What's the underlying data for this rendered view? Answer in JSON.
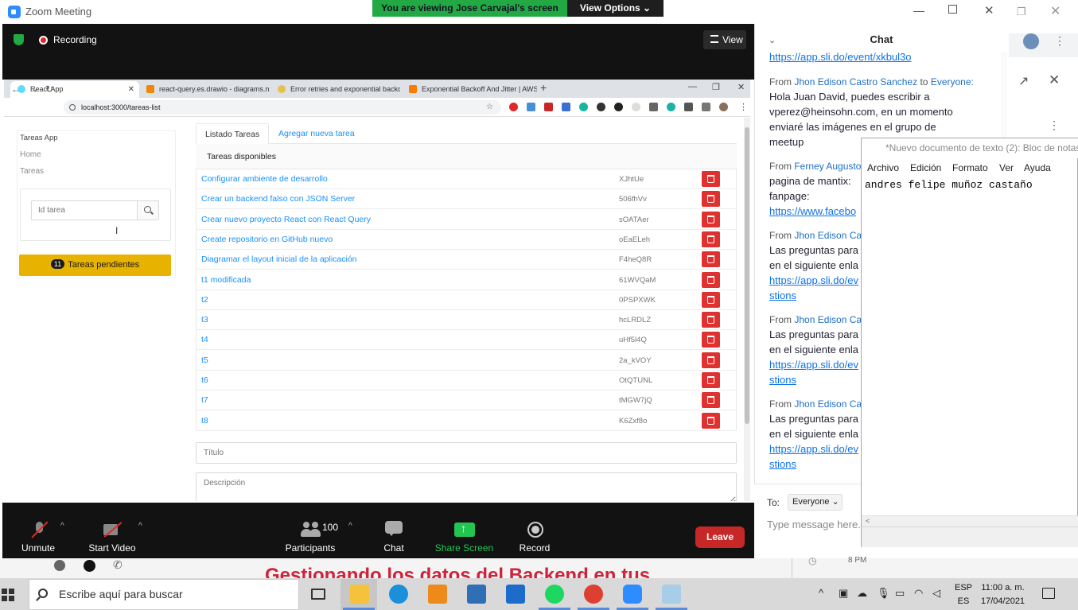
{
  "zoom": {
    "title": "Zoom Meeting",
    "viewing_banner": "You are viewing Jose Carvajal's screen",
    "view_options": "View Options ⌄",
    "recording": "Recording",
    "view": "View",
    "controls": {
      "unmute": "Unmute",
      "start_video": "Start Video",
      "participants": "Participants",
      "participant_count": "100",
      "chat": "Chat",
      "share_screen": "Share Screen",
      "record": "Record",
      "leave": "Leave"
    }
  },
  "chrome": {
    "tabs": [
      {
        "label": "React App",
        "active": true
      },
      {
        "label": "react-query.es.drawio - diagrams.net"
      },
      {
        "label": "Error retries and exponential backoff"
      },
      {
        "label": "Exponential Backoff And Jitter | AWS"
      }
    ],
    "url": "localhost:3000/tareas-list"
  },
  "app": {
    "sidebar": {
      "title": "Tareas App",
      "links": [
        "Home",
        "Tareas"
      ],
      "search_placeholder": "Id tarea",
      "pending_count": "11",
      "pending_label": "Tareas pendientes"
    },
    "tabs": [
      "Listado Tareas",
      "Agregar nueva tarea"
    ],
    "table_title": "Tareas disponibles",
    "tasks": [
      {
        "title": "Configurar ambiente de desarrollo",
        "id": "XJhtUe"
      },
      {
        "title": "Crear un backend falso con JSON Server",
        "id": "506fhVv"
      },
      {
        "title": "Crear nuevo proyecto React con React Query",
        "id": "sOATAer"
      },
      {
        "title": "Create repositorio en GitHub nuevo",
        "id": "oEaELeh"
      },
      {
        "title": "Diagramar el layout inicial de la aplicación",
        "id": "F4heQ8R"
      },
      {
        "title": "t1 modificada",
        "id": "61WVQaM"
      },
      {
        "title": "t2",
        "id": "0PSPXWK"
      },
      {
        "title": "t3",
        "id": "hcLRDLZ"
      },
      {
        "title": "t4",
        "id": "uHf5l4Q"
      },
      {
        "title": "t5",
        "id": "2a_kVOY"
      },
      {
        "title": "t6",
        "id": "OtQTUNL"
      },
      {
        "title": "t7",
        "id": "tMGW7jQ"
      },
      {
        "title": "t8",
        "id": "K6Zxf8o"
      }
    ],
    "titulo_placeholder": "Título",
    "descripcion_placeholder": "Descripción"
  },
  "chat": {
    "title": "Chat",
    "top_link": "https://app.sli.do/event/xkbul3o",
    "messages": [
      {
        "from": "Jhon Edison Castro Sanchez",
        "to": "Everyone:",
        "lines": [
          "Hola Juan David, puedes escribir a",
          "vperez@heinsohn.com, en un momento",
          "enviaré las imágenes en el grupo de",
          "meetup"
        ]
      },
      {
        "from": "Ferney Augusto",
        "lines": [
          "pagina de mantix:",
          "fanpage:"
        ],
        "link": "https://www.facebo"
      },
      {
        "from": "Jhon Edison Cas",
        "lines": [
          "Las preguntas para",
          "en el siguiente enla"
        ],
        "link": "https://app.sli.do/ev",
        "tail": "stions"
      },
      {
        "from": "Jhon Edison Cas",
        "lines": [
          "Las preguntas para",
          "en el siguiente enla"
        ],
        "link": "https://app.sli.do/ev",
        "tail": "stions"
      },
      {
        "from": "Jhon Edison Cas",
        "lines": [
          "Las preguntas para",
          "en el siguiente enla"
        ],
        "link": "https://app.sli.do/ev",
        "tail": "stions"
      }
    ],
    "from_word": "From",
    "to_word": "to",
    "to_label": "To:",
    "to_value": "Everyone ⌄",
    "input_placeholder": "Type message here..."
  },
  "notepad": {
    "title": "*Nuevo documento de texto (2): Bloc de notas",
    "menu": [
      "Archivo",
      "Edición",
      "Formato",
      "Ver",
      "Ayuda"
    ],
    "content": "andres felipe muñoz castaño"
  },
  "background": {
    "heading": "Gestionando los datos del Backend en tus",
    "time_label": "8 PM"
  },
  "taskbar": {
    "search_placeholder": "Escribe aquí para buscar",
    "lang_top": "ESP",
    "lang_bottom": "ES",
    "time": "11:00 a. m.",
    "date": "17/04/2021"
  },
  "colors": {
    "zoom_green": "#23a944",
    "zoom_dark": "#121212",
    "antd_blue": "#1890ff",
    "delete_red": "#e03131",
    "pending_yellow": "#e8b200",
    "leave_red": "#c62828"
  }
}
